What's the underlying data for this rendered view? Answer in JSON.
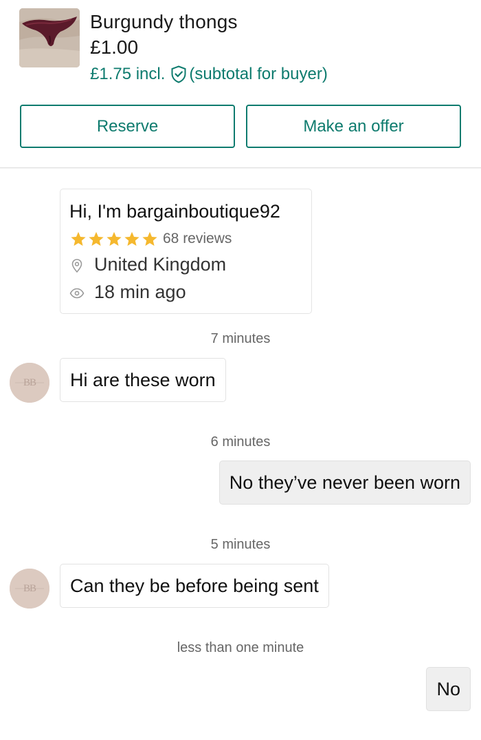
{
  "item": {
    "title": "Burgundy thongs",
    "price": "£1.00",
    "incl_price": "£1.75 incl.",
    "incl_note": "(subtotal for buyer)",
    "thumbnail_icon": "item-photo"
  },
  "actions": {
    "reserve_label": "Reserve",
    "offer_label": "Make an offer"
  },
  "profile": {
    "greeting": "Hi, I'm bargainboutique92",
    "rating_stars": 5,
    "reviews": "68 reviews",
    "location": "United Kingdom",
    "last_seen": "18 min ago"
  },
  "messages": [
    {
      "time": "7 minutes",
      "from": "other",
      "text": "Hi are these worn"
    },
    {
      "time": "6 minutes",
      "from": "me",
      "text": "No they’ve never been worn"
    },
    {
      "time": "5 minutes",
      "from": "other",
      "text": "Can they be before being sent"
    },
    {
      "time": "less than one minute",
      "from": "me",
      "text": "No"
    }
  ],
  "avatar_initials": "BB",
  "colors": {
    "accent": "#0e7b6e",
    "star": "#f5b82e",
    "avatar_bg": "#dccac0"
  }
}
